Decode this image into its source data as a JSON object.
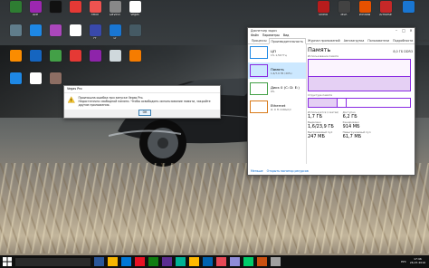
{
  "desktop": {
    "icons": [
      {
        "label": "",
        "color": "#2e7d32"
      },
      {
        "label": "Ace",
        "color": "#9c27b0"
      },
      {
        "label": "",
        "color": "#111111"
      },
      {
        "label": "",
        "color": "#e53935"
      },
      {
        "label": "Fetch",
        "color": "#ef5350"
      },
      {
        "label": "DaVinci",
        "color": "#888888"
      },
      {
        "label": "Vegas",
        "color": "#ffffff"
      },
      {
        "label": "",
        "color": "#607d8b"
      },
      {
        "label": "",
        "color": "#1e88e5"
      },
      {
        "label": "",
        "color": "#ab47bc"
      },
      {
        "label": "",
        "color": "#ffffff"
      },
      {
        "label": "Pr",
        "color": "#3949ab"
      },
      {
        "label": "Lr",
        "color": "#1976d2"
      },
      {
        "label": "",
        "color": "#455a64"
      },
      {
        "label": "",
        "color": "#fb8c00"
      },
      {
        "label": "",
        "color": "#1565c0"
      },
      {
        "label": "",
        "color": "#43a047"
      },
      {
        "label": "",
        "color": "#e53935"
      },
      {
        "label": "",
        "color": "#8e24aa"
      },
      {
        "label": "",
        "color": "#cfd8dc"
      },
      {
        "label": "",
        "color": "#f57c00"
      },
      {
        "label": "",
        "color": "#1e88e5"
      },
      {
        "label": "",
        "color": "#ffffff"
      },
      {
        "label": "",
        "color": "#8d6e63"
      }
    ],
    "right_icons": [
      {
        "label": "Shield",
        "color": "#b71c1c"
      },
      {
        "label": "MSR",
        "color": "#424242"
      },
      {
        "label": "Window",
        "color": "#e65100"
      },
      {
        "label": "Armorse",
        "color": "#c62828"
      },
      {
        "label": "",
        "color": "#1976d2"
      }
    ]
  },
  "dialog": {
    "title": "Vegas Pro",
    "line1": "Произошла ошибка при запуске Vegas Pro.",
    "line2": "Недостаточно свободной памяти. Чтобы освободить использование памяти, закройте другие приложения.",
    "ok": "ОК"
  },
  "taskmanager": {
    "title": "Диспетчер задач",
    "menu": [
      "Файл",
      "Параметры",
      "Вид"
    ],
    "tabs": [
      "Процессы",
      "Производительность",
      "Журнал приложений",
      "Автозагрузка",
      "Пользователи",
      "Подробности",
      "Службы"
    ],
    "resources": [
      {
        "name": "ЦП",
        "sub": "1% 1,59 ГГц",
        "color": "#1e88e5"
      },
      {
        "name": "Память",
        "sub": "1,6/7,9 ГБ (20%)",
        "color": "#8a2be2"
      },
      {
        "name": "Диск 0 (C: D: E:)",
        "sub": "0%",
        "color": "#43a047"
      },
      {
        "name": "Ethernet",
        "sub": "О: 0 П: 0 Кбит/с",
        "color": "#d87a1a"
      }
    ],
    "panel": {
      "heading": "Память",
      "total": "8,0 ГБ DDR3",
      "usage_label": "Использование памяти",
      "comp_label": "Структура памяти",
      "stats": [
        {
          "k": "Используется (сжатая)",
          "v": "1,7 ГБ"
        },
        {
          "k": "Доступно",
          "v": "6,2 ГБ"
        },
        {
          "k": "",
          "v": ""
        },
        {
          "k": "Выделено",
          "v": "1,6/23,9 ГБ"
        },
        {
          "k": "Кэшировано",
          "v": "914 МБ"
        },
        {
          "k": "",
          "v": ""
        },
        {
          "k": "Выгружаемый пул",
          "v": "247 МБ"
        },
        {
          "k": "Невыгружаемый пул",
          "v": "61,7 МБ"
        },
        {
          "k": "",
          "v": ""
        }
      ]
    },
    "footer": [
      "Меньше",
      "Открыть монитор ресурсов"
    ]
  },
  "taskbar": {
    "search_placeholder": "",
    "clock_time": "17:46",
    "clock_date": "26.07.2016",
    "lang": "РУС"
  }
}
